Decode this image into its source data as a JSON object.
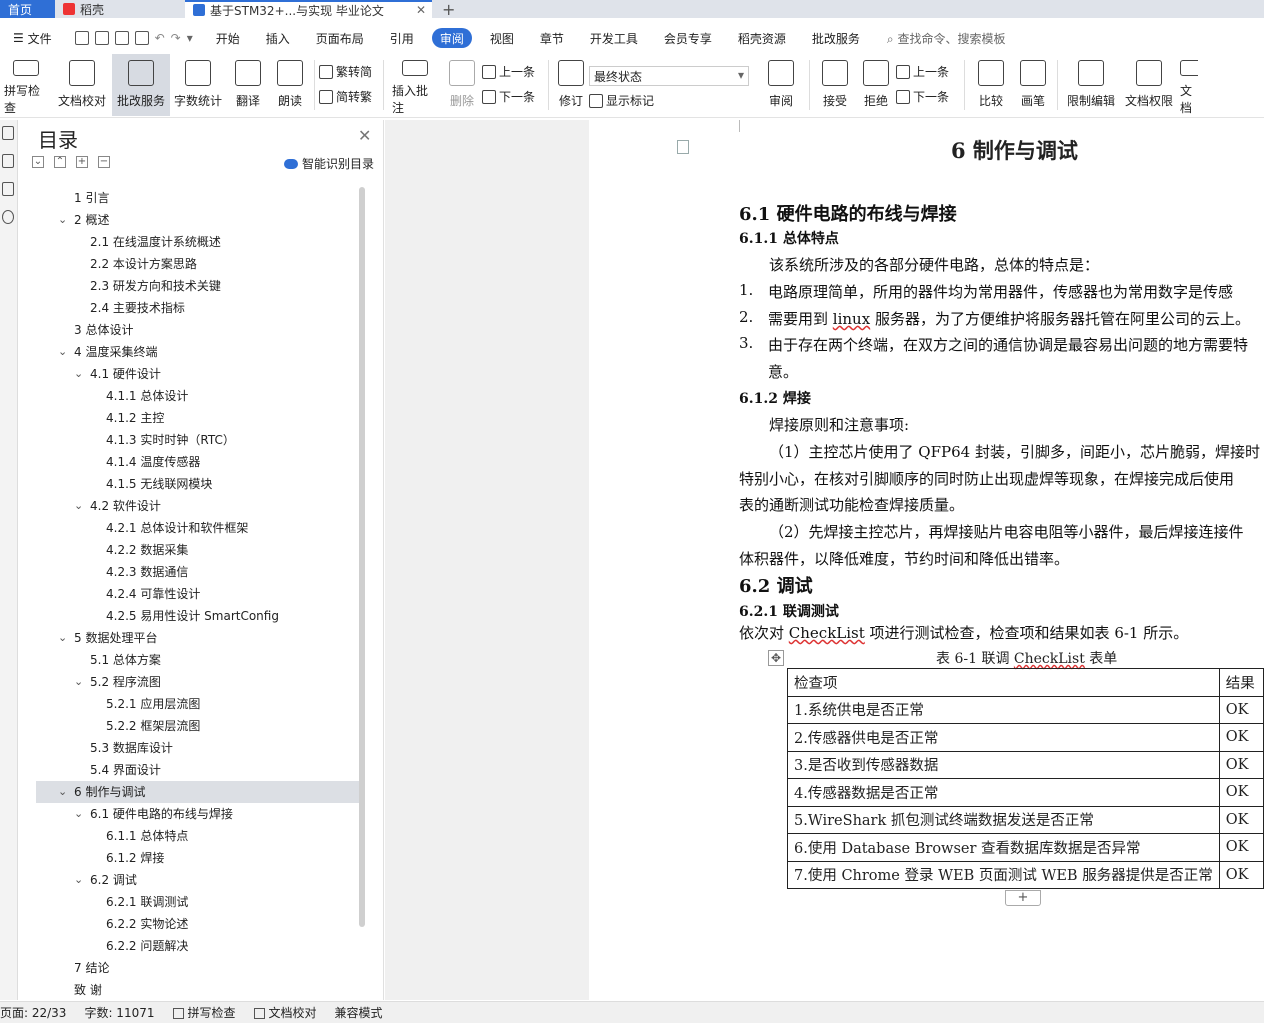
{
  "tabs": {
    "home": "首页",
    "wps": "稻壳",
    "doc": "基于STM32+...与实现 毕业论文"
  },
  "menu": {
    "file": "文件",
    "items": [
      "开始",
      "插入",
      "页面布局",
      "引用",
      "审阅",
      "视图",
      "章节",
      "开发工具",
      "会员专享",
      "稻壳资源",
      "批改服务"
    ],
    "active": "审阅",
    "search": "查找命令、搜索模板"
  },
  "ribbon": {
    "spell": "拼写检查",
    "proof": "文档校对",
    "correct": "批改服务",
    "wordcount": "字数统计",
    "translate": "翻译",
    "read": "朗读",
    "trad": "繁转简",
    "simp": "简转繁",
    "insert_comment": "插入批注",
    "delete": "删除",
    "prev": "上一条",
    "next": "下一条",
    "revise": "修订",
    "final_state": "最终状态",
    "show_marks": "显示标记",
    "review": "审阅",
    "accept": "接受",
    "reject": "拒绝",
    "prev2": "上一条",
    "next2": "下一条",
    "compare": "比较",
    "pen": "画笔",
    "restrict": "限制编辑",
    "doc_perm": "文档权限",
    "doc_more": "文档"
  },
  "nav": {
    "title": "目录",
    "smart": "智能识别目录",
    "items": [
      {
        "t": "1   引言",
        "l": 0,
        "c": false
      },
      {
        "t": "2   概述",
        "l": 0,
        "c": true
      },
      {
        "t": "2.1   在线温度计系统概述",
        "l": 1,
        "c": false
      },
      {
        "t": "2.2   本设计方案思路",
        "l": 1,
        "c": false
      },
      {
        "t": "2.3   研发方向和技术关键",
        "l": 1,
        "c": false
      },
      {
        "t": "2.4   主要技术指标",
        "l": 1,
        "c": false
      },
      {
        "t": "3   总体设计",
        "l": 0,
        "c": false
      },
      {
        "t": "4   温度采集终端",
        "l": 0,
        "c": true
      },
      {
        "t": "4.1   硬件设计",
        "l": 1,
        "c": true
      },
      {
        "t": "4.1.1  总体设计",
        "l": 2,
        "c": false
      },
      {
        "t": "4.1.2  主控",
        "l": 2,
        "c": false
      },
      {
        "t": "4.1.3  实时时钟（RTC）",
        "l": 2,
        "c": false
      },
      {
        "t": "4.1.4  温度传感器",
        "l": 2,
        "c": false
      },
      {
        "t": "4.1.5  无线联网模块",
        "l": 2,
        "c": false
      },
      {
        "t": "4.2   软件设计",
        "l": 1,
        "c": true
      },
      {
        "t": "4.2.1  总体设计和软件框架",
        "l": 2,
        "c": false
      },
      {
        "t": "4.2.2  数据采集",
        "l": 2,
        "c": false
      },
      {
        "t": "4.2.3  数据通信",
        "l": 2,
        "c": false
      },
      {
        "t": "4.2.4  可靠性设计",
        "l": 2,
        "c": false
      },
      {
        "t": "4.2.5  易用性设计 SmartConfig",
        "l": 2,
        "c": false
      },
      {
        "t": "5   数据处理平台",
        "l": 0,
        "c": true
      },
      {
        "t": "5.1   总体方案",
        "l": 1,
        "c": false
      },
      {
        "t": "5.2   程序流图",
        "l": 1,
        "c": true
      },
      {
        "t": "5.2.1 应用层流图",
        "l": 2,
        "c": false
      },
      {
        "t": "5.2.2 框架层流图",
        "l": 2,
        "c": false
      },
      {
        "t": "5.3   数据库设计",
        "l": 1,
        "c": false
      },
      {
        "t": "5.4   界面设计",
        "l": 1,
        "c": false
      },
      {
        "t": "6   制作与调试",
        "l": 0,
        "c": true,
        "active": true
      },
      {
        "t": "6.1   硬件电路的布线与焊接",
        "l": 1,
        "c": true
      },
      {
        "t": "6.1.1   总体特点",
        "l": 2,
        "c": false
      },
      {
        "t": "6.1.2   焊接",
        "l": 2,
        "c": false
      },
      {
        "t": "6.2   调试",
        "l": 1,
        "c": true
      },
      {
        "t": "6.2.1   联调测试",
        "l": 2,
        "c": false
      },
      {
        "t": "6.2.2   实物论述",
        "l": 2,
        "c": false
      },
      {
        "t": "6.2.2   问题解决",
        "l": 2,
        "c": false
      },
      {
        "t": "7   结论",
        "l": 0,
        "c": false
      },
      {
        "t": "致   谢",
        "l": 0,
        "c": false
      }
    ]
  },
  "doc": {
    "h1": "6   制作与调试",
    "s61": "6.1   硬件电路的布线与焊接",
    "s611": "6.1.1   总体特点",
    "p1": "该系统所涉及的各部分硬件电路，总体的特点是：",
    "l1n": "1.",
    "l1": "电路原理简单，所用的器件均为常用器件，传感器也为常用数字是传感",
    "l2n": "2.",
    "l2a": "需要用到 ",
    "l2b": "linux",
    "l2c": " 服务器，为了方便维护将服务器托管在阿里公司的云上。",
    "l3n": "3.",
    "l3": "由于存在两个终端，在双方之间的通信协调是最容易出问题的地方需要特",
    "l3b": "意。",
    "s612": "6.1.2   焊接",
    "p2": "焊接原则和注意事项:",
    "p3": "（1）主控芯片使用了 QFP64 封装，引脚多，间距小，芯片脆弱，焊接时",
    "p3b": "特别小心，在核对引脚顺序的同时防止出现虚焊等现象，在焊接完成后使用",
    "p3c": "表的通断测试功能检查焊接质量。",
    "p4": "（2）先焊接主控芯片，再焊接贴片电容电阻等小器件，最后焊接连接件",
    "p4b": "体积器件，以降低难度，节约时间和降低出错率。",
    "s62": "6.2   调试",
    "s621": "6.2.1   联调测试",
    "p5a": "依次对 ",
    "p5b": "CheckList",
    "p5c": " 项进行测试检查，检查项和结果如表 6-1 所示。",
    "cap_a": "表 6-1   联调 ",
    "cap_b": "CheckList",
    "cap_c": " 表单",
    "table": {
      "head": [
        "检查项",
        "结果"
      ],
      "rows": [
        [
          "1.系统供电是否正常",
          "OK"
        ],
        [
          "2.传感器供电是否正常",
          "OK"
        ],
        [
          "3.是否收到传感器数据",
          "OK"
        ],
        [
          "4.传感器数据是否正常",
          "OK"
        ],
        [
          "5.WireShark 抓包测试终端数据发送是否正常",
          "OK"
        ],
        [
          "6.使用 Database Browser 查看数据库数据是否异常",
          "OK"
        ],
        [
          "7.使用 Chrome 登录 WEB 页面测试 WEB 服务器提供是否正常",
          "OK"
        ]
      ]
    }
  },
  "status": {
    "page": "页面: 22/33",
    "words": "字数: 11071",
    "spell": "拼写检查",
    "proof": "文档校对",
    "compat": "兼容模式"
  }
}
